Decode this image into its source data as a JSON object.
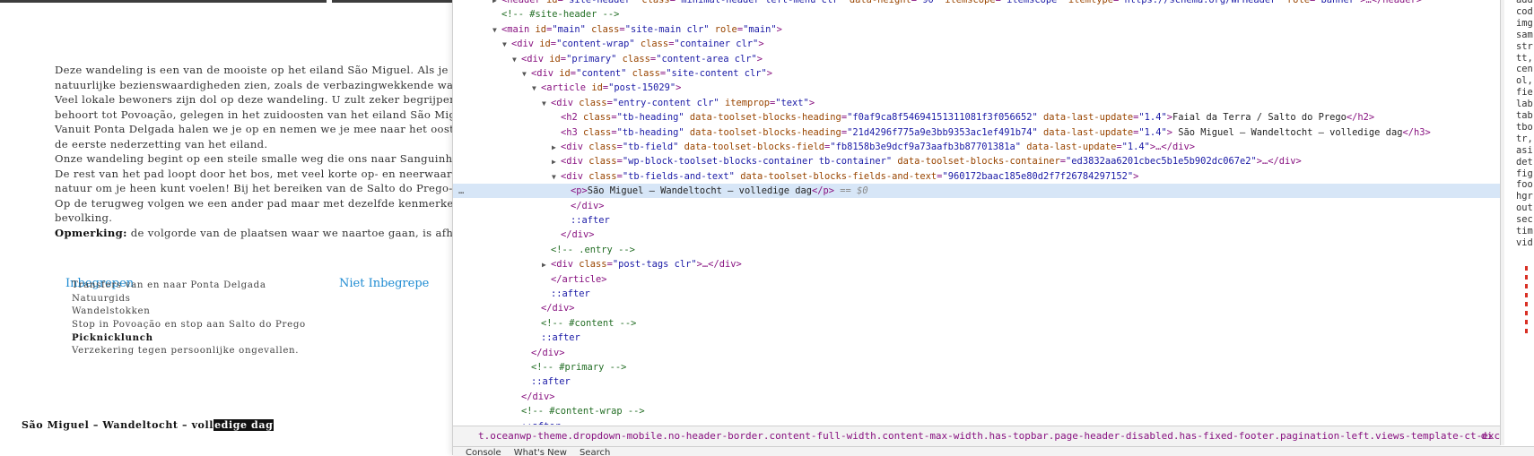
{
  "page": {
    "paragraph_lines": [
      "Deze wandeling is een van de mooiste op het eiland São Miguel. Als je één w",
      "natuurlijke bezienswaardigheden zien, zoals de verbazingwekkende waterval",
      "Veel lokale bewoners zijn dol op deze wandeling. U zult zeker begrijpen waa",
      "behoort tot Povoação, gelegen in het zuidoosten van het eiland São Miguel. D",
      "Vanuit Ponta Delgada halen we je op en nemen we je mee naar het oostelijke",
      "de eerste nederzetting van het eiland.",
      "Onze wandeling begint op een steile smalle weg die ons naar Sanguinho leidt",
      "De rest van het pad loopt door het bos, met veel korte op- en neerwaartse stu",
      "natuur om je heen kunt voelen! Bij het bereiken van de Salto do Prego-waterv",
      "Op de terugweg volgen we een ander pad maar met dezelfde kenmerken. Op h",
      "bevolking."
    ],
    "note_label": "Opmerking:",
    "note_text": " de volgorde van de plaatsen waar we naartoe gaan, is afhankelij",
    "included_heading": "Inbegrepen",
    "not_included_heading": "Niet Inbegrepe",
    "included_items": [
      "Transfers van en naar Ponta Delgada",
      "Natuurgids",
      "Wandelstokken",
      "Stop in Povoação en stop aan Salto do Prego",
      "Picknicklunch",
      "Verzekering tegen persoonlijke ongevallen."
    ],
    "bottom_title_plain": "São Miguel – Wandeltocht – voll",
    "bottom_title_selected": "edige dag"
  },
  "devtools": {
    "breadcrumb": "t.oceanwp-theme.dropdown-mobile.no-header-border.content-full-width.content-max-width.has-topbar.page-header-disabled.has-fixed-footer.pagination-left.views-template-ct-excursie.customize-support",
    "breadcrumb_more": "di",
    "bottom_tabs": [
      "Console",
      "What's New",
      "Search"
    ],
    "styles_fragments": [
      "add",
      "cod",
      "img",
      "sam",
      "str",
      "tt,",
      "cen",
      "ol,",
      "fie",
      "lab",
      "tab",
      "tbo",
      "tr,",
      "asi",
      "det",
      "fig",
      "foo",
      "hgr",
      "out",
      "sec",
      "tim",
      "vid"
    ],
    "rows": [
      {
        "ind": 0,
        "tri": "▶",
        "parts": [
          [
            "t",
            "<header "
          ],
          [
            "a",
            "id"
          ],
          [
            "t",
            "="
          ],
          [
            "v",
            "\"site-header\""
          ],
          [
            "a",
            " class"
          ],
          [
            "t",
            "="
          ],
          [
            "v",
            "\"minimal-header left-menu clr\""
          ],
          [
            "a",
            " data-height"
          ],
          [
            "t",
            "="
          ],
          [
            "v",
            "\"90\""
          ],
          [
            "a",
            " itemscope"
          ],
          [
            "t",
            "="
          ],
          [
            "v",
            "\"itemscope\""
          ],
          [
            "a",
            " itemtype"
          ],
          [
            "t",
            "="
          ],
          [
            "v",
            "\"https://schema.org/WPHeader\""
          ],
          [
            "a",
            " role"
          ],
          [
            "t",
            "="
          ],
          [
            "v",
            "\"banner\""
          ],
          [
            "t",
            ">…</header>"
          ]
        ]
      },
      {
        "ind": 0,
        "tri": "",
        "parts": [
          [
            "c",
            "<!-- #site-header -->"
          ]
        ]
      },
      {
        "ind": 0,
        "tri": "▼",
        "parts": [
          [
            "t",
            "<main "
          ],
          [
            "a",
            "id"
          ],
          [
            "t",
            "="
          ],
          [
            "v",
            "\"main\""
          ],
          [
            "a",
            " class"
          ],
          [
            "t",
            "="
          ],
          [
            "v",
            "\"site-main clr\""
          ],
          [
            "a",
            " role"
          ],
          [
            "t",
            "="
          ],
          [
            "v",
            "\"main\""
          ],
          [
            "t",
            ">"
          ]
        ]
      },
      {
        "ind": 1,
        "tri": "▼",
        "parts": [
          [
            "t",
            "<div "
          ],
          [
            "a",
            "id"
          ],
          [
            "t",
            "="
          ],
          [
            "v",
            "\"content-wrap\""
          ],
          [
            "a",
            " class"
          ],
          [
            "t",
            "="
          ],
          [
            "v",
            "\"container clr\""
          ],
          [
            "t",
            ">"
          ]
        ]
      },
      {
        "ind": 2,
        "tri": "▼",
        "parts": [
          [
            "t",
            "<div "
          ],
          [
            "a",
            "id"
          ],
          [
            "t",
            "="
          ],
          [
            "v",
            "\"primary\""
          ],
          [
            "a",
            " class"
          ],
          [
            "t",
            "="
          ],
          [
            "v",
            "\"content-area clr\""
          ],
          [
            "t",
            ">"
          ]
        ]
      },
      {
        "ind": 3,
        "tri": "▼",
        "parts": [
          [
            "t",
            "<div "
          ],
          [
            "a",
            "id"
          ],
          [
            "t",
            "="
          ],
          [
            "v",
            "\"content\""
          ],
          [
            "a",
            " class"
          ],
          [
            "t",
            "="
          ],
          [
            "v",
            "\"site-content clr\""
          ],
          [
            "t",
            ">"
          ]
        ]
      },
      {
        "ind": 4,
        "tri": "▼",
        "parts": [
          [
            "t",
            "<article "
          ],
          [
            "a",
            "id"
          ],
          [
            "t",
            "="
          ],
          [
            "v",
            "\"post-15029\""
          ],
          [
            "t",
            ">"
          ]
        ]
      },
      {
        "ind": 5,
        "tri": "▼",
        "parts": [
          [
            "t",
            "<div "
          ],
          [
            "a",
            "class"
          ],
          [
            "t",
            "="
          ],
          [
            "v",
            "\"entry-content clr\""
          ],
          [
            "a",
            " itemprop"
          ],
          [
            "t",
            "="
          ],
          [
            "v",
            "\"text\""
          ],
          [
            "t",
            ">"
          ]
        ]
      },
      {
        "ind": 6,
        "tri": "",
        "parts": [
          [
            "t",
            "<h2 "
          ],
          [
            "a",
            "class"
          ],
          [
            "t",
            "="
          ],
          [
            "v",
            "\"tb-heading\""
          ],
          [
            "a",
            " data-toolset-blocks-heading"
          ],
          [
            "t",
            "="
          ],
          [
            "v",
            "\"f0af9ca8f54694151311081f3f056652\""
          ],
          [
            "a",
            " data-last-update"
          ],
          [
            "t",
            "="
          ],
          [
            "v",
            "\"1.4\""
          ],
          [
            "t",
            ">"
          ],
          [
            "x",
            "Faial da Terra / Salto do Prego"
          ],
          [
            "t",
            "</h2>"
          ]
        ]
      },
      {
        "ind": 6,
        "tri": "",
        "parts": [
          [
            "t",
            "<h3 "
          ],
          [
            "a",
            "class"
          ],
          [
            "t",
            "="
          ],
          [
            "v",
            "\"tb-heading\""
          ],
          [
            "a",
            " data-toolset-blocks-heading"
          ],
          [
            "t",
            "="
          ],
          [
            "v",
            "\"21d4296f775a9e3bb9353ac1ef491b74\""
          ],
          [
            "a",
            " data-last-update"
          ],
          [
            "t",
            "="
          ],
          [
            "v",
            "\"1.4\""
          ],
          [
            "t",
            ">"
          ],
          [
            "x",
            " São Miguel – Wandeltocht – volledige dag"
          ],
          [
            "t",
            "</h3>"
          ]
        ]
      },
      {
        "ind": 6,
        "tri": "▶",
        "parts": [
          [
            "t",
            "<div "
          ],
          [
            "a",
            "class"
          ],
          [
            "t",
            "="
          ],
          [
            "v",
            "\"tb-field\""
          ],
          [
            "a",
            " data-toolset-blocks-field"
          ],
          [
            "t",
            "="
          ],
          [
            "v",
            "\"fb8158b3e9dcf9a73aafb3b87701381a\""
          ],
          [
            "a",
            " data-last-update"
          ],
          [
            "t",
            "="
          ],
          [
            "v",
            "\"1.4\""
          ],
          [
            "t",
            ">…</div>"
          ]
        ]
      },
      {
        "ind": 6,
        "tri": "▶",
        "parts": [
          [
            "t",
            "<div "
          ],
          [
            "a",
            "class"
          ],
          [
            "t",
            "="
          ],
          [
            "v",
            "\"wp-block-toolset-blocks-container tb-container\""
          ],
          [
            "a",
            " data-toolset-blocks-container"
          ],
          [
            "t",
            "="
          ],
          [
            "v",
            "\"ed3832aa6201cbec5b1e5b902dc067e2\""
          ],
          [
            "t",
            ">…</div>"
          ]
        ]
      },
      {
        "ind": 6,
        "tri": "▼",
        "parts": [
          [
            "t",
            "<div "
          ],
          [
            "a",
            "class"
          ],
          [
            "t",
            "="
          ],
          [
            "v",
            "\"tb-fields-and-text\""
          ],
          [
            "a",
            " data-toolset-blocks-fields-and-text"
          ],
          [
            "t",
            "="
          ],
          [
            "v",
            "\"960172baac185e80d2f7f26784297152\""
          ],
          [
            "t",
            ">"
          ]
        ]
      },
      {
        "ind": 7,
        "tri": "",
        "sel": true,
        "parts": [
          [
            "t",
            "<p>"
          ],
          [
            "x",
            "São Miguel – Wandeltocht – volledige dag"
          ],
          [
            "t",
            "</p>"
          ],
          [
            "e",
            " == $0"
          ]
        ]
      },
      {
        "ind": 7,
        "tri": "",
        "parts": [
          [
            "t",
            "</div>"
          ]
        ]
      },
      {
        "ind": 7,
        "tri": "",
        "parts": [
          [
            "p",
            "::after"
          ]
        ]
      },
      {
        "ind": 6,
        "tri": "",
        "parts": [
          [
            "t",
            "</div>"
          ]
        ]
      },
      {
        "ind": 5,
        "tri": "",
        "parts": [
          [
            "c",
            "<!-- .entry -->"
          ]
        ]
      },
      {
        "ind": 5,
        "tri": "▶",
        "parts": [
          [
            "t",
            "<div "
          ],
          [
            "a",
            "class"
          ],
          [
            "t",
            "="
          ],
          [
            "v",
            "\"post-tags clr\""
          ],
          [
            "t",
            ">…</div>"
          ]
        ]
      },
      {
        "ind": 5,
        "tri": "",
        "parts": [
          [
            "t",
            "</article>"
          ]
        ]
      },
      {
        "ind": 5,
        "tri": "",
        "parts": [
          [
            "p",
            "::after"
          ]
        ]
      },
      {
        "ind": 4,
        "tri": "",
        "parts": [
          [
            "t",
            "</div>"
          ]
        ]
      },
      {
        "ind": 4,
        "tri": "",
        "parts": [
          [
            "c",
            "<!-- #content -->"
          ]
        ]
      },
      {
        "ind": 4,
        "tri": "",
        "parts": [
          [
            "p",
            "::after"
          ]
        ]
      },
      {
        "ind": 3,
        "tri": "",
        "parts": [
          [
            "t",
            "</div>"
          ]
        ]
      },
      {
        "ind": 3,
        "tri": "",
        "parts": [
          [
            "c",
            "<!-- #primary -->"
          ]
        ]
      },
      {
        "ind": 3,
        "tri": "",
        "parts": [
          [
            "p",
            "::after"
          ]
        ]
      },
      {
        "ind": 2,
        "tri": "",
        "parts": [
          [
            "t",
            "</div>"
          ]
        ]
      },
      {
        "ind": 2,
        "tri": "",
        "parts": [
          [
            "c",
            "<!-- #content-wrap -->"
          ]
        ]
      },
      {
        "ind": 2,
        "tri": "",
        "parts": [
          [
            "p",
            "::after"
          ]
        ]
      }
    ]
  }
}
